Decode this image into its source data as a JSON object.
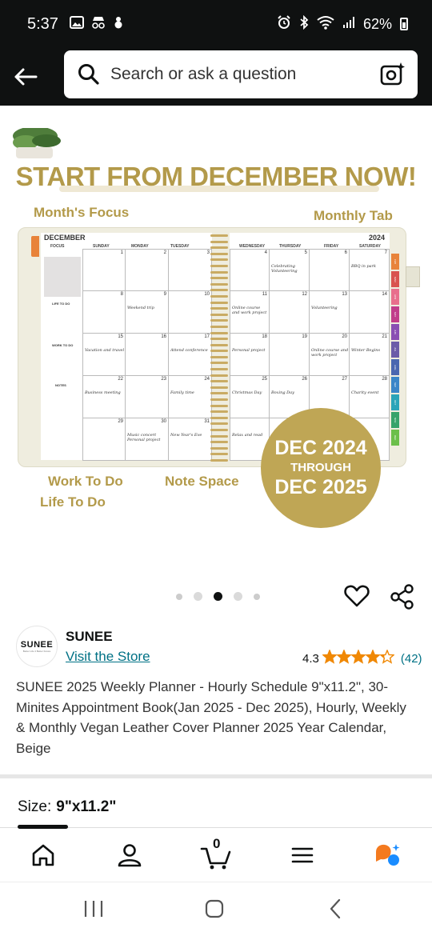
{
  "status_bar": {
    "time": "5:37",
    "battery": "62%"
  },
  "search": {
    "placeholder": "Search or ask a question"
  },
  "product_image": {
    "headline": "START FROM DECEMBER NOW!",
    "callouts": {
      "months_focus": "Month's Focus",
      "monthly_tab": "Monthly Tab",
      "work_to_do": "Work To Do",
      "note_space": "Note Space",
      "life_to_do": "Life To Do"
    },
    "planner": {
      "month": "DECEMBER",
      "year": "2024",
      "side_labels": [
        "FOCUS",
        "LIFE TO DO",
        "WORK TO DO",
        "NOTES"
      ],
      "left_days": [
        "SUNDAY",
        "MONDAY",
        "TUESDAY"
      ],
      "right_days": [
        "WEDNESDAY",
        "THURSDAY",
        "FRIDAY",
        "SATURDAY"
      ],
      "left_rows": [
        [
          {
            "n": "1",
            "note": ""
          },
          {
            "n": "2",
            "note": ""
          },
          {
            "n": "3",
            "note": ""
          }
        ],
        [
          {
            "n": "8",
            "note": ""
          },
          {
            "n": "9",
            "note": "Weekend trip"
          },
          {
            "n": "10",
            "note": ""
          }
        ],
        [
          {
            "n": "15",
            "note": "Vacation and travel"
          },
          {
            "n": "16",
            "note": ""
          },
          {
            "n": "17",
            "note": "Attend conference"
          }
        ],
        [
          {
            "n": "22",
            "note": "Business meeting"
          },
          {
            "n": "23",
            "note": ""
          },
          {
            "n": "24",
            "note": "Family time"
          }
        ],
        [
          {
            "n": "29",
            "note": ""
          },
          {
            "n": "30",
            "note": "Music concert Personal project"
          },
          {
            "n": "31",
            "note": "New Year's Eve"
          }
        ]
      ],
      "right_rows": [
        [
          {
            "n": "4",
            "note": ""
          },
          {
            "n": "5",
            "note": "Celebrating Volunteering"
          },
          {
            "n": "6",
            "note": ""
          },
          {
            "n": "7",
            "note": "BBQ in park"
          }
        ],
        [
          {
            "n": "11",
            "note": "Online course and work project"
          },
          {
            "n": "12",
            "note": ""
          },
          {
            "n": "13",
            "note": "Volunteering"
          },
          {
            "n": "14",
            "note": ""
          }
        ],
        [
          {
            "n": "18",
            "note": "Personal project"
          },
          {
            "n": "19",
            "note": ""
          },
          {
            "n": "20",
            "note": "Online course and work project"
          },
          {
            "n": "21",
            "note": "Winter Begins"
          }
        ],
        [
          {
            "n": "25",
            "note": "Christmas Day"
          },
          {
            "n": "26",
            "note": "Boxing Day"
          },
          {
            "n": "27",
            "note": ""
          },
          {
            "n": "28",
            "note": "Charity event"
          }
        ],
        [
          {
            "n": "",
            "note": "Relax and read"
          },
          {
            "n": "",
            "note": ""
          },
          {
            "n": "",
            "note": ""
          },
          {
            "n": "",
            "note": ""
          }
        ]
      ],
      "month_tabs": [
        "FEB",
        "MAR",
        "APR",
        "MAY",
        "JUN",
        "JUL",
        "AUG",
        "SEP",
        "OCT",
        "NOV",
        "DEC"
      ]
    },
    "badge": {
      "line1": "DEC 2024",
      "line2": "THROUGH",
      "line3": "DEC 2025"
    }
  },
  "carousel": {
    "total": 5,
    "active_index": 2
  },
  "store": {
    "logo_text": "SUNEE",
    "logo_sub": "Better Life 4 Better Future",
    "brand": "SUNEE",
    "visit_label": "Visit the Store",
    "rating_value": "4.3",
    "rating_stars": 4.3,
    "rating_count": "(42)"
  },
  "product": {
    "title": "SUNEE 2025 Weekly Planner - Hourly Schedule 9\"x11.2\", 30-Minites Appointment Book(Jan 2025 - Dec 2025), Hourly, Weekly & Monthly Vegan Leather Cover Planner 2025 Year Calendar, Beige"
  },
  "size": {
    "label": "Size:",
    "value": "9\"x11.2\""
  },
  "bottom_nav": {
    "cart_count": "0"
  },
  "colors": {
    "header_bg": "#0f1111",
    "gold": "#b39a4a",
    "badge_gold": "#bfa655",
    "link": "#007185",
    "star": "#f08804"
  }
}
